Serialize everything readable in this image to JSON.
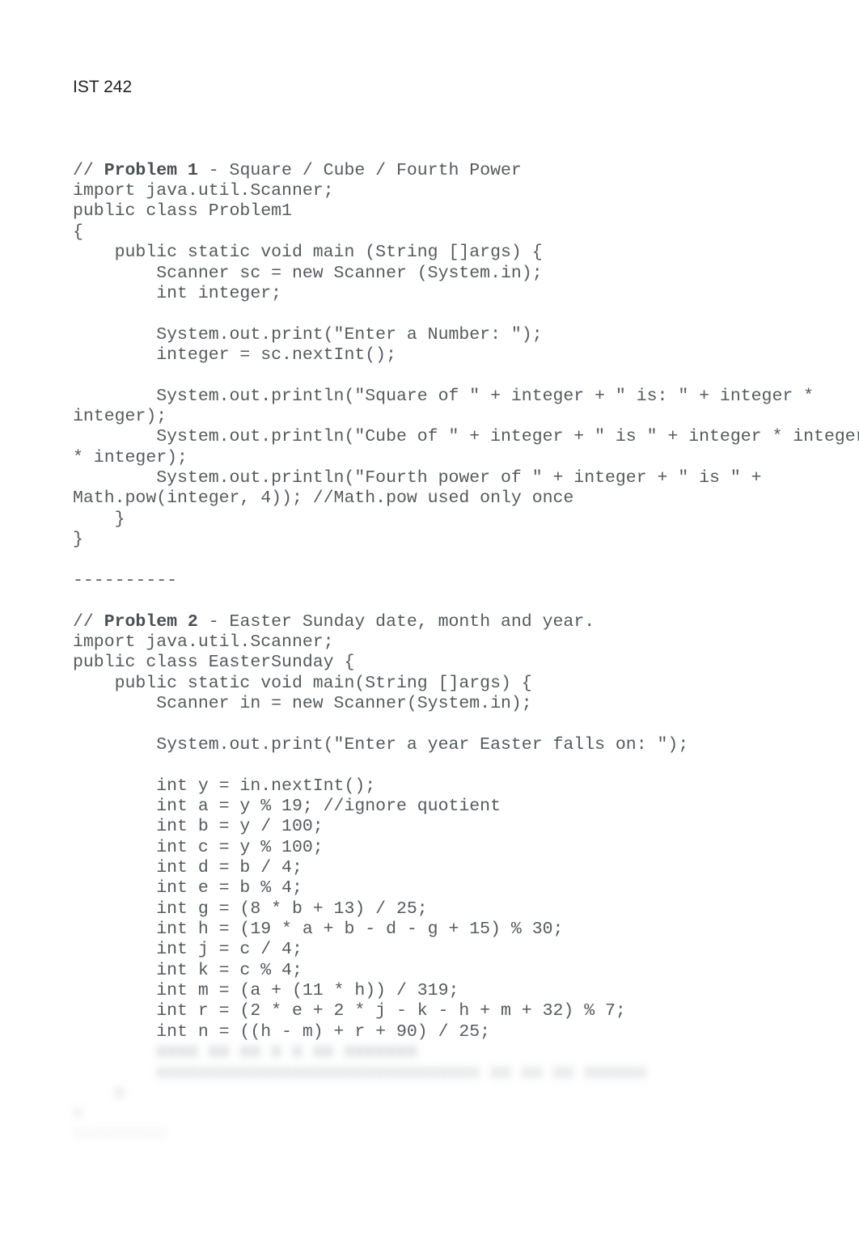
{
  "header": "IST 242",
  "code": {
    "p1_comment_prefix": "// ",
    "p1_title": "Problem 1",
    "p1_comment_suffix": " - Square / Cube / Fourth Power",
    "p1_body": "import java.util.Scanner;\npublic class Problem1\n{\n    public static void main (String []args) {\n        Scanner sc = new Scanner (System.in);\n        int integer;\n\n        System.out.print(\"Enter a Number: \");\n        integer = sc.nextInt();\n\n        System.out.println(\"Square of \" + integer + \" is: \" + integer *\ninteger);\n        System.out.println(\"Cube of \" + integer + \" is \" + integer * integer\n* integer);\n        System.out.println(\"Fourth power of \" + integer + \" is \" +\nMath.pow(integer, 4)); //Math.pow used only once\n    }\n}\n\n----------\n",
    "p2_comment_prefix": "// ",
    "p2_title": "Problem 2",
    "p2_comment_suffix": " - Easter Sunday date, month and year.",
    "p2_body": "import java.util.Scanner;\npublic class EasterSunday {\n    public static void main(String []args) {\n        Scanner in = new Scanner(System.in);\n\n        System.out.print(\"Enter a year Easter falls on: \");\n\n        int y = in.nextInt();\n        int a = y % 19; //ignore quotient\n        int b = y / 100;\n        int c = y % 100;\n        int d = b / 4;\n        int e = b % 4;\n        int g = (8 * b + 13) / 25;\n        int h = (19 * a + b - d - g + 15) % 30;\n        int j = c / 4;\n        int k = c % 4;\n        int m = (a + (11 * h)) / 319;\n        int r = (2 * e + 2 * j - k - h + m + 32) % 7;\n        int n = ((h - m) + r + 90) / 25;"
  },
  "obscured": {
    "line1": "        xxxx xx xx x x xx xxxxxxx",
    "line2": "",
    "line3": "        xxxxxxxxxxxxxxxxxxxxxxxxxxxxxxx xx xx xx xxxxxx",
    "line4": "    x",
    "line5": "x",
    "line6": "",
    "line7": "xxxxxxxxx"
  }
}
